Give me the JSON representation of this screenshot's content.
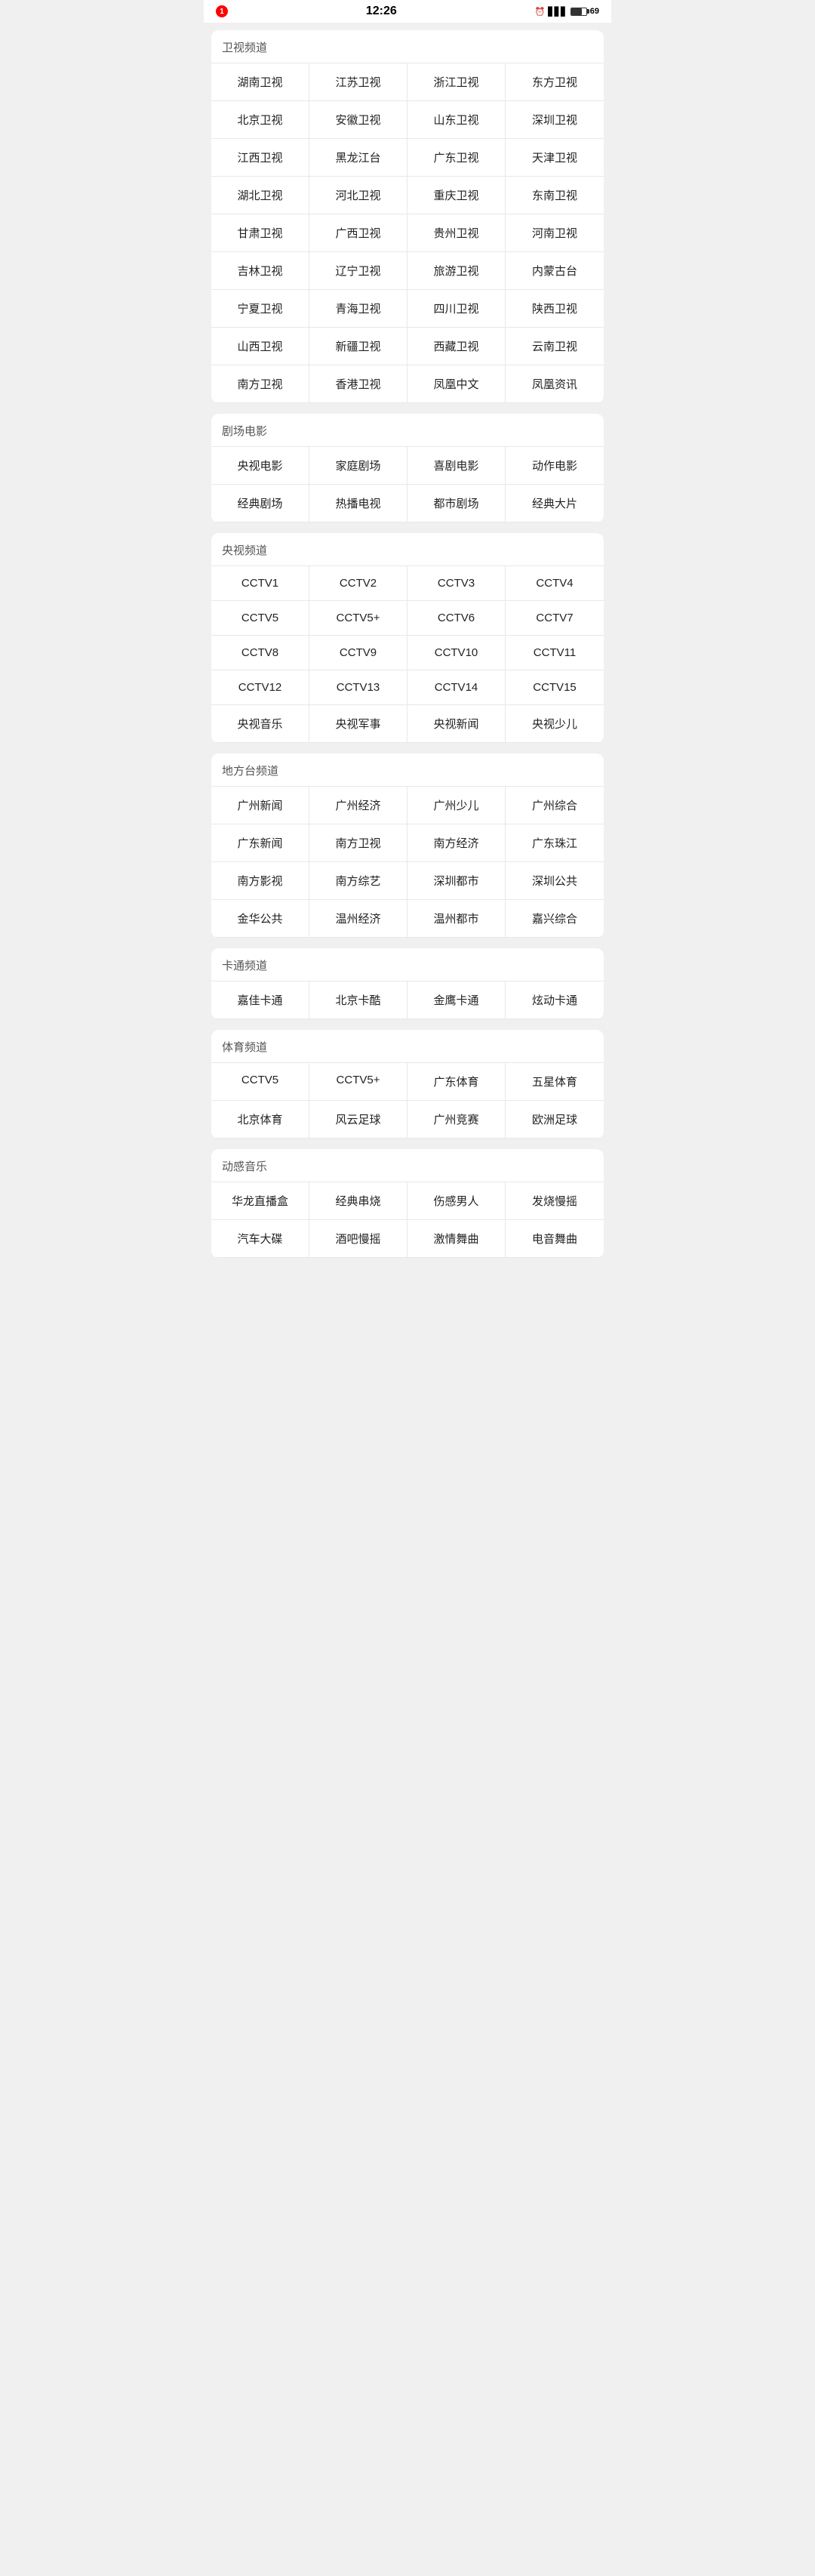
{
  "statusBar": {
    "time": "12:26",
    "notification": "1",
    "batteryLevel": "69"
  },
  "sections": [
    {
      "id": "satellite",
      "title": "卫视频道",
      "channels": [
        "湖南卫视",
        "江苏卫视",
        "浙江卫视",
        "东方卫视",
        "北京卫视",
        "安徽卫视",
        "山东卫视",
        "深圳卫视",
        "江西卫视",
        "黑龙江台",
        "广东卫视",
        "天津卫视",
        "湖北卫视",
        "河北卫视",
        "重庆卫视",
        "东南卫视",
        "甘肃卫视",
        "广西卫视",
        "贵州卫视",
        "河南卫视",
        "吉林卫视",
        "辽宁卫视",
        "旅游卫视",
        "内蒙古台",
        "宁夏卫视",
        "青海卫视",
        "四川卫视",
        "陕西卫视",
        "山西卫视",
        "新疆卫视",
        "西藏卫视",
        "云南卫视",
        "南方卫视",
        "香港卫视",
        "凤凰中文",
        "凤凰资讯"
      ]
    },
    {
      "id": "drama-movies",
      "title": "剧场电影",
      "channels": [
        "央视电影",
        "家庭剧场",
        "喜剧电影",
        "动作电影",
        "经典剧场",
        "热播电视",
        "都市剧场",
        "经典大片"
      ]
    },
    {
      "id": "cctv",
      "title": "央视频道",
      "channels": [
        "CCTV1",
        "CCTV2",
        "CCTV3",
        "CCTV4",
        "CCTV5",
        "CCTV5+",
        "CCTV6",
        "CCTV7",
        "CCTV8",
        "CCTV9",
        "CCTV10",
        "CCTV11",
        "CCTV12",
        "CCTV13",
        "CCTV14",
        "CCTV15",
        "央视音乐",
        "央视军事",
        "央视新闻",
        "央视少儿"
      ]
    },
    {
      "id": "local",
      "title": "地方台频道",
      "channels": [
        "广州新闻",
        "广州经济",
        "广州少儿",
        "广州综合",
        "广东新闻",
        "南方卫视",
        "南方经济",
        "广东珠江",
        "南方影视",
        "南方综艺",
        "深圳都市",
        "深圳公共",
        "金华公共",
        "温州经济",
        "温州都市",
        "嘉兴综合"
      ]
    },
    {
      "id": "cartoon",
      "title": "卡通频道",
      "channels": [
        "嘉佳卡通",
        "北京卡酷",
        "金鹰卡通",
        "炫动卡通"
      ]
    },
    {
      "id": "sports",
      "title": "体育频道",
      "channels": [
        "CCTV5",
        "CCTV5+",
        "广东体育",
        "五星体育",
        "北京体育",
        "风云足球",
        "广州竞赛",
        "欧洲足球"
      ]
    },
    {
      "id": "music",
      "title": "动感音乐",
      "channels": [
        "华龙直播盒",
        "经典串烧",
        "伤感男人",
        "发烧慢摇",
        "汽车大碟",
        "酒吧慢摇",
        "激情舞曲",
        "电音舞曲"
      ]
    }
  ]
}
